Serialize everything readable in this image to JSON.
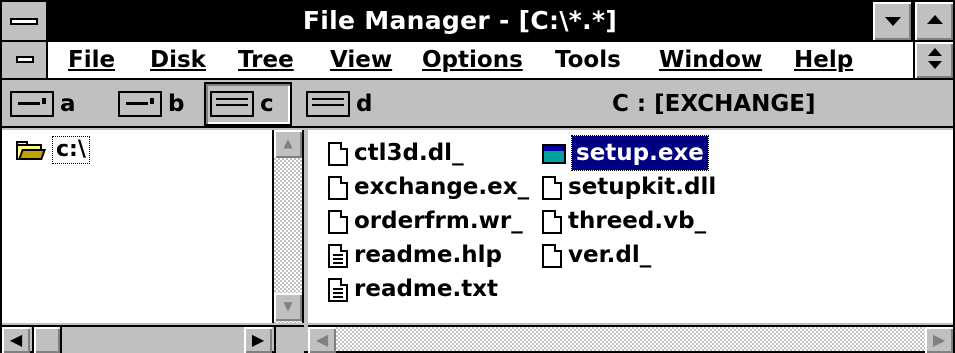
{
  "window": {
    "title": "File Manager - [C:\\*.*]"
  },
  "menu": {
    "items": [
      "File",
      "Disk",
      "Tree",
      "View",
      "Options",
      "Tools",
      "Window",
      "Help"
    ]
  },
  "drives": [
    {
      "letter": "a",
      "type": "floppy",
      "selected": false
    },
    {
      "letter": "b",
      "type": "floppy",
      "selected": false
    },
    {
      "letter": "c",
      "type": "hard-disk",
      "selected": true
    },
    {
      "letter": "d",
      "type": "hard-disk",
      "selected": false
    }
  ],
  "volume_label": "C : [EXCHANGE]",
  "tree": {
    "items": [
      {
        "label": "c:\\",
        "icon": "open-folder-icon",
        "selected": true
      }
    ]
  },
  "files": [
    {
      "name": "ctl3d.dl_",
      "icon": "file-icon"
    },
    {
      "name": "exchange.ex_",
      "icon": "file-icon"
    },
    {
      "name": "orderfrm.wr_",
      "icon": "file-icon"
    },
    {
      "name": "readme.hlp",
      "icon": "document-icon"
    },
    {
      "name": "readme.txt",
      "icon": "document-icon"
    },
    {
      "name": "setup.exe",
      "icon": "program-icon",
      "selected": true
    },
    {
      "name": "setupkit.dll",
      "icon": "file-icon"
    },
    {
      "name": "threed.vb_",
      "icon": "file-icon"
    },
    {
      "name": "ver.dl_",
      "icon": "file-icon"
    }
  ],
  "colors": {
    "title_bar": "#000000",
    "selection": "#000080",
    "chrome": "#c0c0c0"
  }
}
